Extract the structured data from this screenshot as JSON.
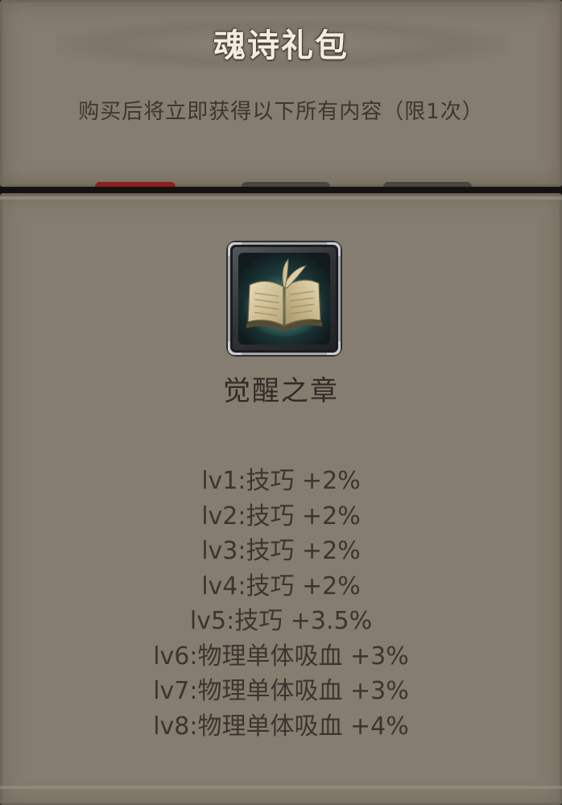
{
  "popup": {
    "title": "魂诗礼包",
    "subtitle": "购买后将立即获得以下所有内容（限1次）"
  },
  "item": {
    "name": "觉醒之章",
    "icon": "open-book-icon"
  },
  "levels": [
    "lv1:技巧 +2%",
    "lv2:技巧 +2%",
    "lv3:技巧 +2%",
    "lv4:技巧 +2%",
    "lv5:技巧 +3.5%",
    "lv6:物理单体吸血 +3%",
    "lv7:物理单体吸血 +3%",
    "lv8:物理单体吸血 +4%"
  ],
  "colors": {
    "panel": "#857d6f",
    "title_text": "#f3ece0",
    "body_text": "#3a362f",
    "accent_red": "#8c1f1f"
  }
}
